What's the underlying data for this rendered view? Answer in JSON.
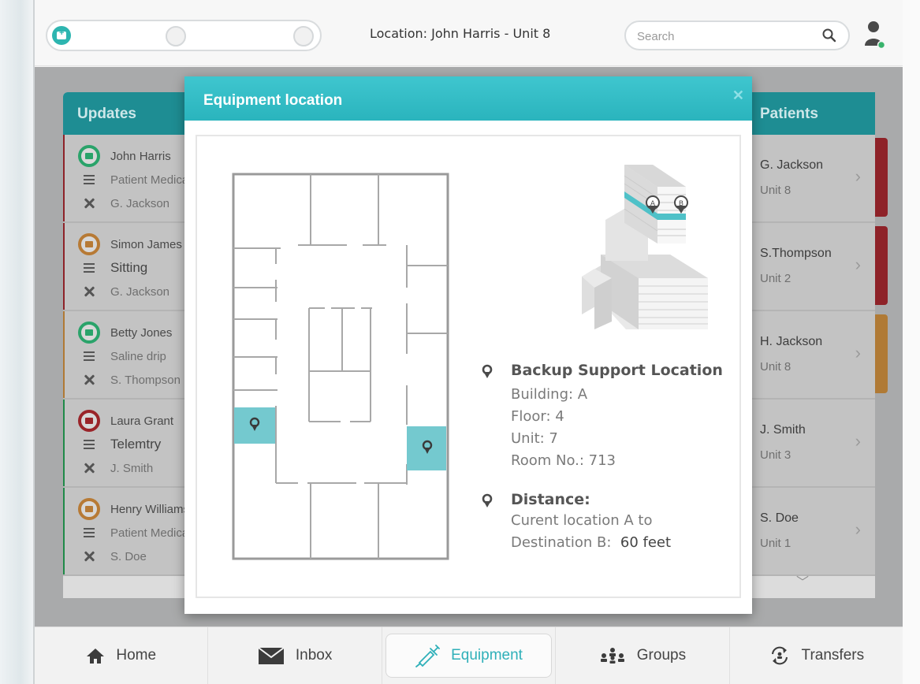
{
  "topbar": {
    "location_label": "Location: John Harris - Unit 8",
    "search_placeholder": "Search"
  },
  "updates": {
    "title": "Updates",
    "items": [
      {
        "patient": "John Harris",
        "note": "Patient Medication",
        "staff": "G. Jackson",
        "status_color": "#c0262b",
        "badge_color": "#2aa36a"
      },
      {
        "patient": "Simon James",
        "note": "Sitting",
        "staff": "G. Jackson",
        "status_color": "#c0262b",
        "badge_color": "#d98a2e"
      },
      {
        "patient": "Betty Jones",
        "note": "Saline drip",
        "staff": "S. Thompson",
        "status_color": "#e8962c",
        "badge_color": "#2aa36a"
      },
      {
        "patient": "Laura Grant",
        "note": "Telemtry",
        "staff": "J. Smith",
        "status_color": "#23a84e",
        "badge_color": "#b3262d"
      },
      {
        "patient": "Henry Williams",
        "note": "Patient Medication",
        "staff": "S. Doe",
        "status_color": "#23a84e",
        "badge_color": "#d98a2e"
      }
    ]
  },
  "patients": {
    "title": "Patients",
    "items": [
      {
        "name": "G. Jackson",
        "unit": "Unit 8",
        "status_color": "#c0262b"
      },
      {
        "name": "S.Thompson",
        "unit": "Unit 2",
        "status_color": "#c0262b"
      },
      {
        "name": "H. Jackson",
        "unit": "Unit 8",
        "status_color": "#e8962c"
      },
      {
        "name": "J. Smith",
        "unit": "Unit 3",
        "status_color": ""
      },
      {
        "name": "S. Doe",
        "unit": "Unit 1",
        "status_color": ""
      }
    ]
  },
  "modal": {
    "title": "Equipment location",
    "close_icon": "close-icon",
    "building_pins": [
      "A",
      "B"
    ],
    "backup": {
      "title": "Backup Support Location",
      "building": "Building: A",
      "floor": "Floor: 4",
      "unit": "Unit: 7",
      "room": "Room No.: 713"
    },
    "distance": {
      "title": "Distance:",
      "line1": "Curent location A to",
      "line2_prefix": "Destination B:",
      "line2_value": "60 feet"
    }
  },
  "nav": {
    "home": "Home",
    "inbox": "Inbox",
    "equipment": "Equipment",
    "groups": "Groups",
    "transfers": "Transfers",
    "active": "equipment"
  },
  "colors": {
    "accent": "#2fb0b9",
    "header_teal": "#1e8d93",
    "highlight_room": "#74c9cf"
  }
}
